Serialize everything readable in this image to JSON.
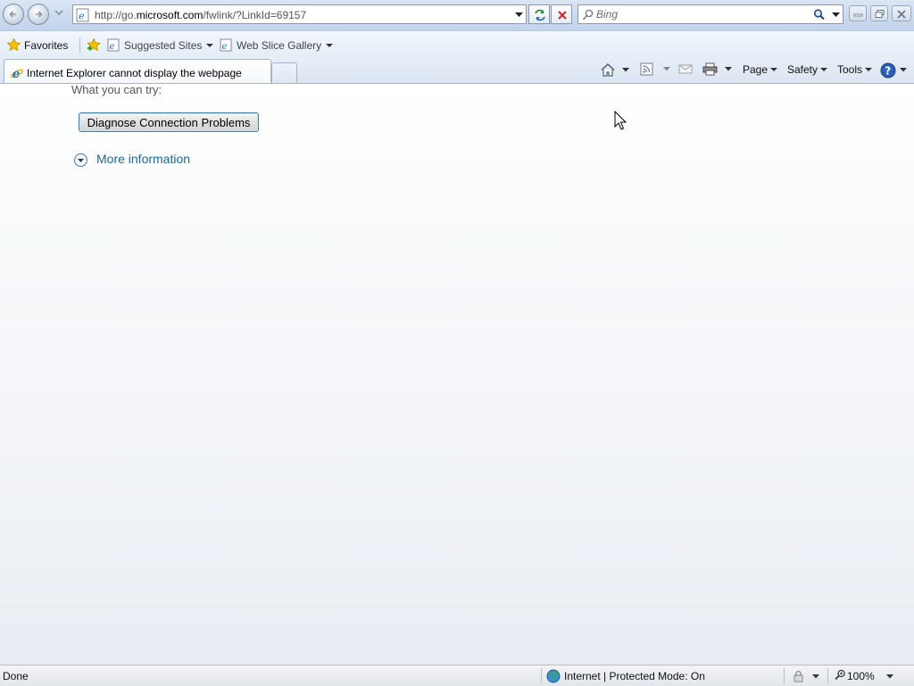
{
  "browser": {
    "address": {
      "prefix": "http://go.",
      "domain": "microsoft.com",
      "suffix": "/fwlink/?LinkId=69157"
    },
    "search": {
      "placeholder": "Bing"
    }
  },
  "favorites_bar": {
    "favorites_label": "Favorites",
    "items": [
      {
        "label": "Suggested Sites"
      },
      {
        "label": "Web Slice Gallery"
      }
    ]
  },
  "tabs": [
    {
      "title": "Internet Explorer cannot display the webpage",
      "active": true
    }
  ],
  "command_bar": {
    "page_label": "Page",
    "safety_label": "Safety",
    "tools_label": "Tools"
  },
  "content": {
    "try_text": "What you can try:",
    "diagnose_label": "Diagnose Connection Problems",
    "more_info_label": "More information"
  },
  "status_bar": {
    "status": "Done",
    "zone": "Internet | Protected Mode: On",
    "zoom": "100%"
  },
  "colors": {
    "link": "#1d6797",
    "chrome": "#dbe6f4"
  }
}
